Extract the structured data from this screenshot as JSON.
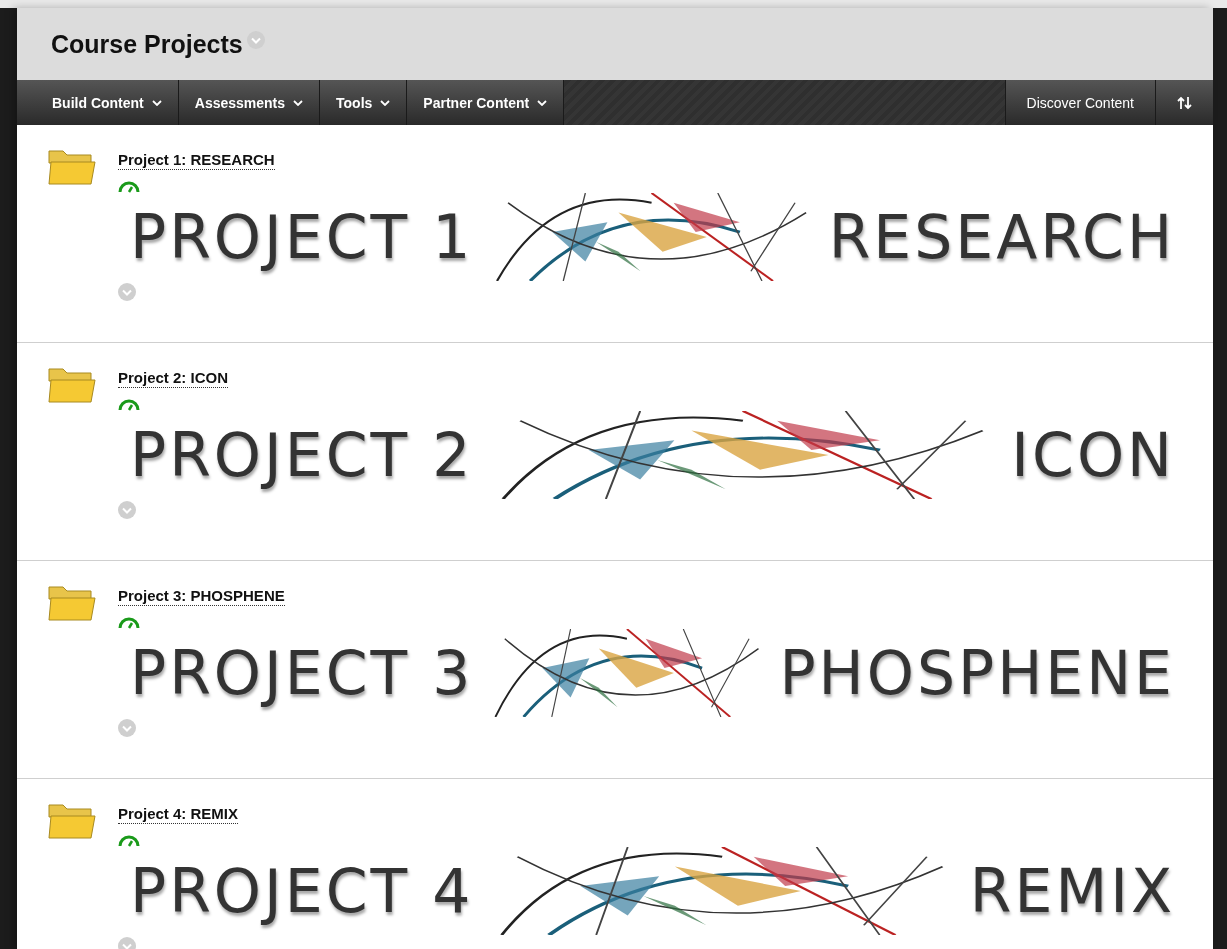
{
  "page": {
    "title": "Course Projects"
  },
  "toolbar": {
    "menus": [
      {
        "label": "Build Content"
      },
      {
        "label": "Assessments"
      },
      {
        "label": "Tools"
      },
      {
        "label": "Partner Content"
      }
    ],
    "discover": {
      "label": "Discover Content"
    }
  },
  "items": [
    {
      "title": "Project 1: RESEARCH",
      "banner_left": "PROJECT 1",
      "banner_right": "RESEARCH"
    },
    {
      "title": "Project 2: ICON",
      "banner_left": "PROJECT 2",
      "banner_right": "ICON"
    },
    {
      "title": "Project 3: PHOSPHENE",
      "banner_left": "PROJECT 3",
      "banner_right": "PHOSPHENE"
    },
    {
      "title": "Project 4: REMIX",
      "banner_left": "PROJECT 4",
      "banner_right": "REMIX"
    }
  ]
}
